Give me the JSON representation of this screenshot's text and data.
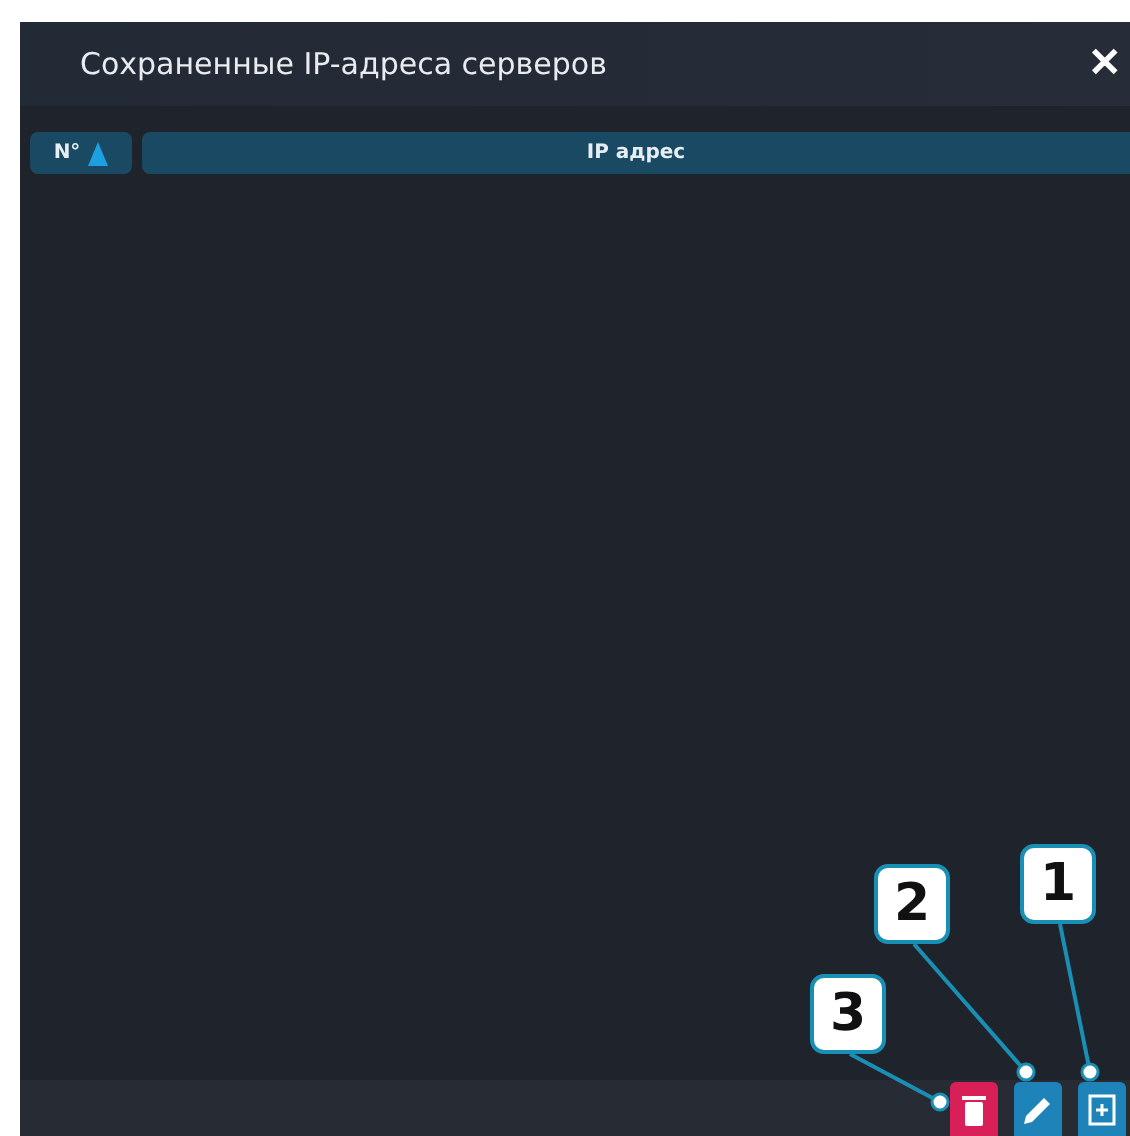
{
  "window": {
    "title": "Сохраненные IP-адреса серверов",
    "close": "✕"
  },
  "table": {
    "columns": [
      {
        "label": "N°",
        "sorted": true
      },
      {
        "label": "IP адрес",
        "sorted": false
      }
    ]
  },
  "toolbar": [
    {
      "kind": "delete"
    },
    {
      "kind": "edit"
    },
    {
      "kind": "add"
    }
  ],
  "callouts": [
    {
      "label": "1"
    },
    {
      "label": "2"
    },
    {
      "label": "3"
    }
  ]
}
